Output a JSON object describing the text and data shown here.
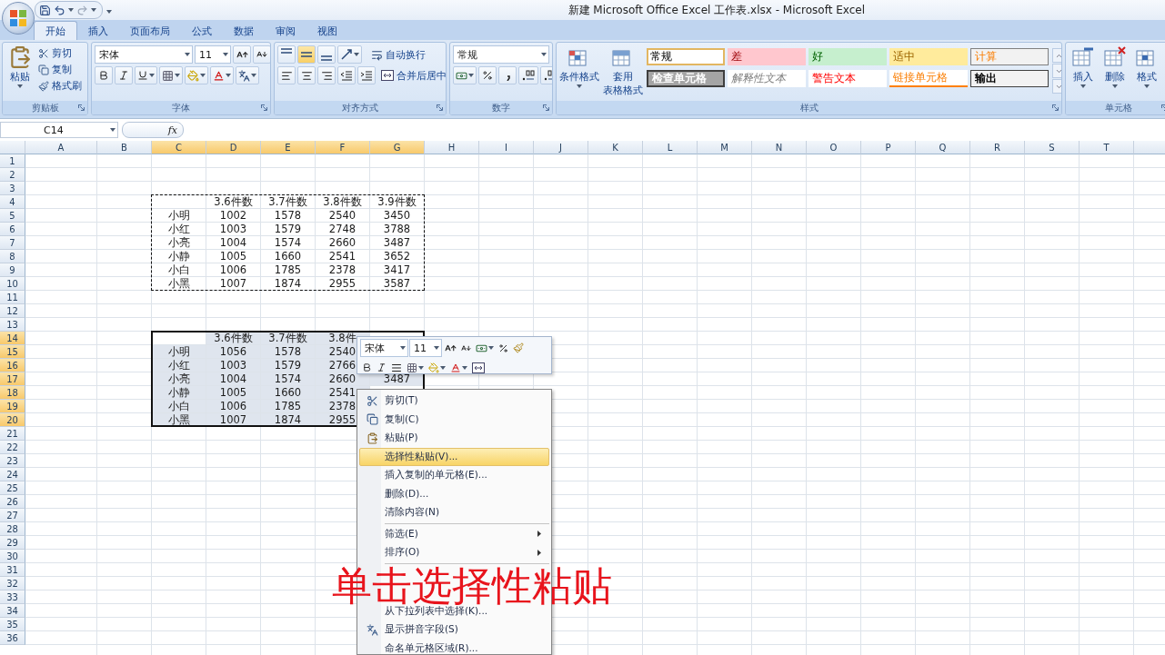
{
  "title_bar": {
    "title": "新建 Microsoft Office Excel 工作表.xlsx - Microsoft Excel"
  },
  "tabs": [
    {
      "label": "开始",
      "selected": true
    },
    {
      "label": "插入",
      "selected": false
    },
    {
      "label": "页面布局",
      "selected": false
    },
    {
      "label": "公式",
      "selected": false
    },
    {
      "label": "数据",
      "selected": false
    },
    {
      "label": "审阅",
      "selected": false
    },
    {
      "label": "视图",
      "selected": false
    }
  ],
  "ribbon": {
    "clipboard": {
      "label": "剪贴板",
      "paste": "粘贴",
      "commands": [
        {
          "kind": "cut",
          "label": "剪切"
        },
        {
          "kind": "copy",
          "label": "复制"
        },
        {
          "kind": "brush",
          "label": "格式刷"
        }
      ]
    },
    "font": {
      "label": "字体",
      "font_name": "宋体",
      "font_size": "11"
    },
    "alignment": {
      "label": "对齐方式",
      "vertical": [
        {
          "selected": false
        },
        {
          "selected": true
        },
        {
          "selected": false
        }
      ],
      "wrap": "自动换行",
      "merge": "合并后居中"
    },
    "number": {
      "label": "数字",
      "format": "常规"
    },
    "styles": {
      "label": "样式",
      "conditional": "条件格式",
      "table_format": [
        "套用",
        "表格格式"
      ],
      "cell_styles": [
        {
          "kind": "normal",
          "label": "常规",
          "selected": true
        },
        {
          "kind": "bad",
          "label": "差",
          "selected": false
        },
        {
          "kind": "good",
          "label": "好",
          "selected": false
        },
        {
          "kind": "neutral",
          "label": "适中",
          "selected": false
        },
        {
          "kind": "calc",
          "label": "计算",
          "selected": false
        },
        {
          "kind": "check",
          "label": "检查单元格",
          "selected": false
        },
        {
          "kind": "explanatory",
          "label": "解释性文本",
          "selected": false
        },
        {
          "kind": "warning",
          "label": "警告文本",
          "selected": false
        },
        {
          "kind": "linked",
          "label": "链接单元格",
          "selected": false
        },
        {
          "kind": "output",
          "label": "输出",
          "selected": false
        }
      ]
    },
    "cells": {
      "label": "单元格",
      "commands": [
        {
          "kind": "insert",
          "label": "插入"
        },
        {
          "kind": "delete",
          "label": "删除"
        },
        {
          "kind": "format",
          "label": "格式"
        }
      ]
    }
  },
  "formula_bar": {
    "name_box": "C14",
    "function_label": "fx"
  },
  "sheet": {
    "columns": [
      {
        "label": "A",
        "selected": false
      },
      {
        "label": "B",
        "selected": false
      },
      {
        "label": "C",
        "selected": true
      },
      {
        "label": "D",
        "selected": true
      },
      {
        "label": "E",
        "selected": true
      },
      {
        "label": "F",
        "selected": true
      },
      {
        "label": "G",
        "selected": true
      },
      {
        "label": "H",
        "selected": false
      },
      {
        "label": "I",
        "selected": false
      },
      {
        "label": "J",
        "selected": false
      },
      {
        "label": "K",
        "selected": false
      },
      {
        "label": "L",
        "selected": false
      },
      {
        "label": "M",
        "selected": false
      },
      {
        "label": "N",
        "selected": false
      },
      {
        "label": "O",
        "selected": false
      },
      {
        "label": "P",
        "selected": false
      },
      {
        "label": "Q",
        "selected": false
      },
      {
        "label": "R",
        "selected": false
      },
      {
        "label": "S",
        "selected": false
      },
      {
        "label": "T",
        "selected": false
      }
    ],
    "rows": [
      {
        "label": "1",
        "selected": false
      },
      {
        "label": "2",
        "selected": false
      },
      {
        "label": "3",
        "selected": false
      },
      {
        "label": "4",
        "selected": false
      },
      {
        "label": "5",
        "selected": false
      },
      {
        "label": "6",
        "selected": false
      },
      {
        "label": "7",
        "selected": false
      },
      {
        "label": "8",
        "selected": false
      },
      {
        "label": "9",
        "selected": false
      },
      {
        "label": "10",
        "selected": false
      },
      {
        "label": "11",
        "selected": false
      },
      {
        "label": "12",
        "selected": false
      },
      {
        "label": "13",
        "selected": false
      },
      {
        "label": "14",
        "selected": true
      },
      {
        "label": "15",
        "selected": true
      },
      {
        "label": "16",
        "selected": true
      },
      {
        "label": "17",
        "selected": true
      },
      {
        "label": "18",
        "selected": true
      },
      {
        "label": "19",
        "selected": true
      },
      {
        "label": "20",
        "selected": true
      },
      {
        "label": "21",
        "selected": false
      },
      {
        "label": "22",
        "selected": false
      },
      {
        "label": "23",
        "selected": false
      },
      {
        "label": "24",
        "selected": false
      },
      {
        "label": "25",
        "selected": false
      },
      {
        "label": "26",
        "selected": false
      },
      {
        "label": "27",
        "selected": false
      },
      {
        "label": "28",
        "selected": false
      },
      {
        "label": "29",
        "selected": false
      },
      {
        "label": "30",
        "selected": false
      },
      {
        "label": "31",
        "selected": false
      },
      {
        "label": "32",
        "selected": false
      },
      {
        "label": "33",
        "selected": false
      },
      {
        "label": "34",
        "selected": false
      },
      {
        "label": "35",
        "selected": false
      },
      {
        "label": "36",
        "selected": false
      }
    ],
    "blocks": [
      {
        "kind": "copied",
        "header": [
          "3.6件数",
          "3.7件数",
          "3.8件数",
          "3.9件数"
        ],
        "rows": [
          {
            "name": "小明",
            "values": [
              "1002",
              "1578",
              "2540",
              "3450"
            ]
          },
          {
            "name": "小红",
            "values": [
              "1003",
              "1579",
              "2748",
              "3788"
            ]
          },
          {
            "name": "小亮",
            "values": [
              "1004",
              "1574",
              "2660",
              "3487"
            ]
          },
          {
            "name": "小静",
            "values": [
              "1005",
              "1660",
              "2541",
              "3652"
            ]
          },
          {
            "name": "小白",
            "values": [
              "1006",
              "1785",
              "2378",
              "3417"
            ]
          },
          {
            "name": "小黑",
            "values": [
              "1007",
              "1874",
              "2955",
              "3587"
            ]
          }
        ]
      },
      {
        "kind": "selected",
        "header": [
          "3.6件数",
          "3.7件数",
          "3.8件"
        ],
        "rows": [
          {
            "name": "小明",
            "values": [
              "1056",
              "1578",
              "2540"
            ]
          },
          {
            "name": "小红",
            "values": [
              "1003",
              "1579",
              "2766"
            ]
          },
          {
            "name": "小亮",
            "values": [
              "1004",
              "1574",
              "2660",
              "3487"
            ]
          },
          {
            "name": "小静",
            "values": [
              "1005",
              "1660",
              "2541"
            ]
          },
          {
            "name": "小白",
            "values": [
              "1006",
              "1785",
              "2378"
            ]
          },
          {
            "name": "小黑",
            "values": [
              "1007",
              "1874",
              "2955"
            ]
          }
        ]
      }
    ]
  },
  "mini_toolbar": {
    "font_name": "宋体",
    "font_size": "11"
  },
  "context_menu": {
    "items": [
      {
        "kind": "cut",
        "label": "剪切(T)",
        "selected": false
      },
      {
        "kind": "copy",
        "label": "复制(C)",
        "selected": false
      },
      {
        "kind": "paste",
        "label": "粘贴(P)",
        "selected": false
      },
      {
        "kind": "plain",
        "label": "选择性粘贴(V)...",
        "selected": true
      },
      {
        "kind": "plain",
        "label": "插入复制的单元格(E)...",
        "selected": false
      },
      {
        "kind": "plain",
        "label": "删除(D)...",
        "selected": false
      },
      {
        "kind": "plain",
        "label": "清除内容(N)",
        "selected": false
      },
      {
        "kind": "separator"
      },
      {
        "kind": "submenu",
        "label": "筛选(E)",
        "selected": false
      },
      {
        "kind": "submenu",
        "label": "排序(O)",
        "selected": false
      },
      {
        "kind": "separator"
      },
      {
        "kind": "covered"
      },
      {
        "kind": "covered"
      },
      {
        "kind": "plain",
        "label": "从下拉列表中选择(K)...",
        "selected": false
      },
      {
        "kind": "phonetic",
        "label": "显示拼音字段(S)",
        "selected": false
      },
      {
        "kind": "plain",
        "label": "命名单元格区域(R)...",
        "selected": false
      }
    ]
  },
  "caption": "单击选择性粘贴"
}
